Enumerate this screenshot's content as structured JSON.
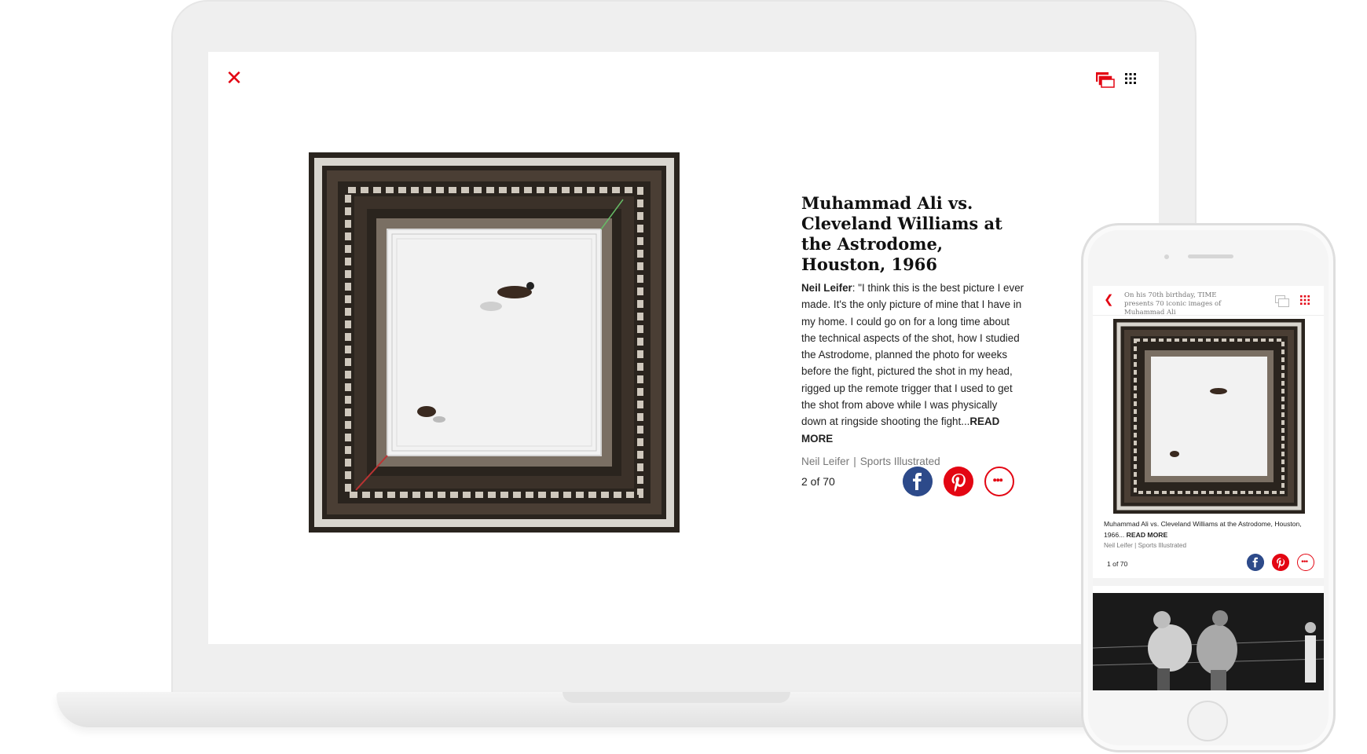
{
  "laptop": {
    "close_icon": "close-icon",
    "slides_view_icon": "slides-view-icon",
    "grid_view_icon": "grid-view-icon",
    "photo_alt": "Aerial view of boxing ring at the Astrodome",
    "title": "Muhammad Ali vs. Cleveland Williams at the Astrodome, Houston, 1966",
    "author": "Neil Leifer",
    "body": ": \"I think this is the best picture I ever made. It's the only picture of mine that I have in my home. I could go on for a long time about the technical aspects of the shot, how I studied the Astrodome, planned the photo for weeks before the fight, pictured the shot in my head, rigged up the remote trigger that I used to get the shot from above while I was physically down at ringside shooting the fight...",
    "read_more": "READ MORE",
    "credit_photographer": "Neil Leifer",
    "credit_separator": "|",
    "credit_source": "Sports Illustrated",
    "counter": "2 of 70",
    "share_icons": [
      "facebook-icon",
      "pinterest-icon",
      "more-icon"
    ]
  },
  "phone": {
    "headline": "On his 70th birthday, TIME presents 70 iconic images of Muhammad Ali",
    "caption": "Muhammad Ali vs. Cleveland Williams at the Astrodome, Houston, 1966...",
    "read_more": "READ MORE",
    "credit_photographer": "Neil Leifer",
    "credit_separator": "|",
    "credit_source": "Sports Illustrated",
    "counter": "1 of 70"
  },
  "colors": {
    "accent": "#e30613",
    "facebook": "#2d4a8a",
    "ring_canvas": "#f2f2f2",
    "crowd_dark": "#2a241e"
  }
}
